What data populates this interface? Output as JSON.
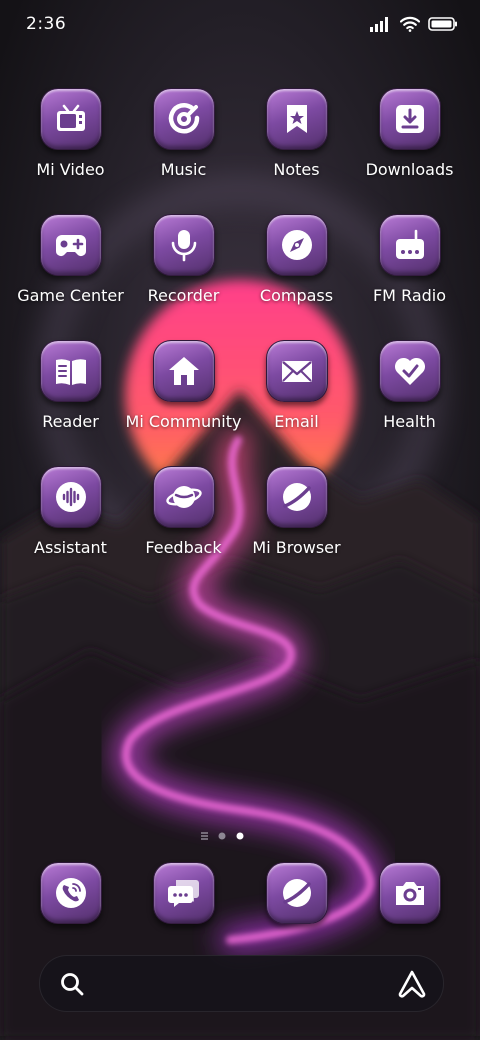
{
  "status_bar": {
    "time": "2:36"
  },
  "apps": [
    {
      "label": "Mi Video",
      "icon": "tv-icon"
    },
    {
      "label": "Music",
      "icon": "music-disc-icon"
    },
    {
      "label": "Notes",
      "icon": "bookmark-star-icon"
    },
    {
      "label": "Downloads",
      "icon": "download-icon"
    },
    {
      "label": "Game Center",
      "icon": "gamepad-icon"
    },
    {
      "label": "Recorder",
      "icon": "microphone-icon"
    },
    {
      "label": "Compass",
      "icon": "compass-icon"
    },
    {
      "label": "FM Radio",
      "icon": "radio-icon"
    },
    {
      "label": "Reader",
      "icon": "book-icon"
    },
    {
      "label": "Mi Community",
      "icon": "home-icon"
    },
    {
      "label": "Email",
      "icon": "envelope-icon"
    },
    {
      "label": "Health",
      "icon": "heart-icon"
    },
    {
      "label": "Assistant",
      "icon": "voice-wave-icon"
    },
    {
      "label": "Feedback",
      "icon": "planet-icon"
    },
    {
      "label": "Mi Browser",
      "icon": "browser-icon"
    }
  ],
  "dock": [
    {
      "name": "phone",
      "icon": "phone-icon"
    },
    {
      "name": "messages",
      "icon": "messages-icon"
    },
    {
      "name": "browser",
      "icon": "browser-icon"
    },
    {
      "name": "camera",
      "icon": "camera-icon"
    }
  ],
  "page_indicator": {
    "pages": 2,
    "current": 2
  },
  "colors": {
    "icon_tile_top": "#b97bd6",
    "icon_tile_bottom": "#53306c",
    "sun_top": "#ff3f8a",
    "sun_bottom": "#ff7a3a"
  }
}
